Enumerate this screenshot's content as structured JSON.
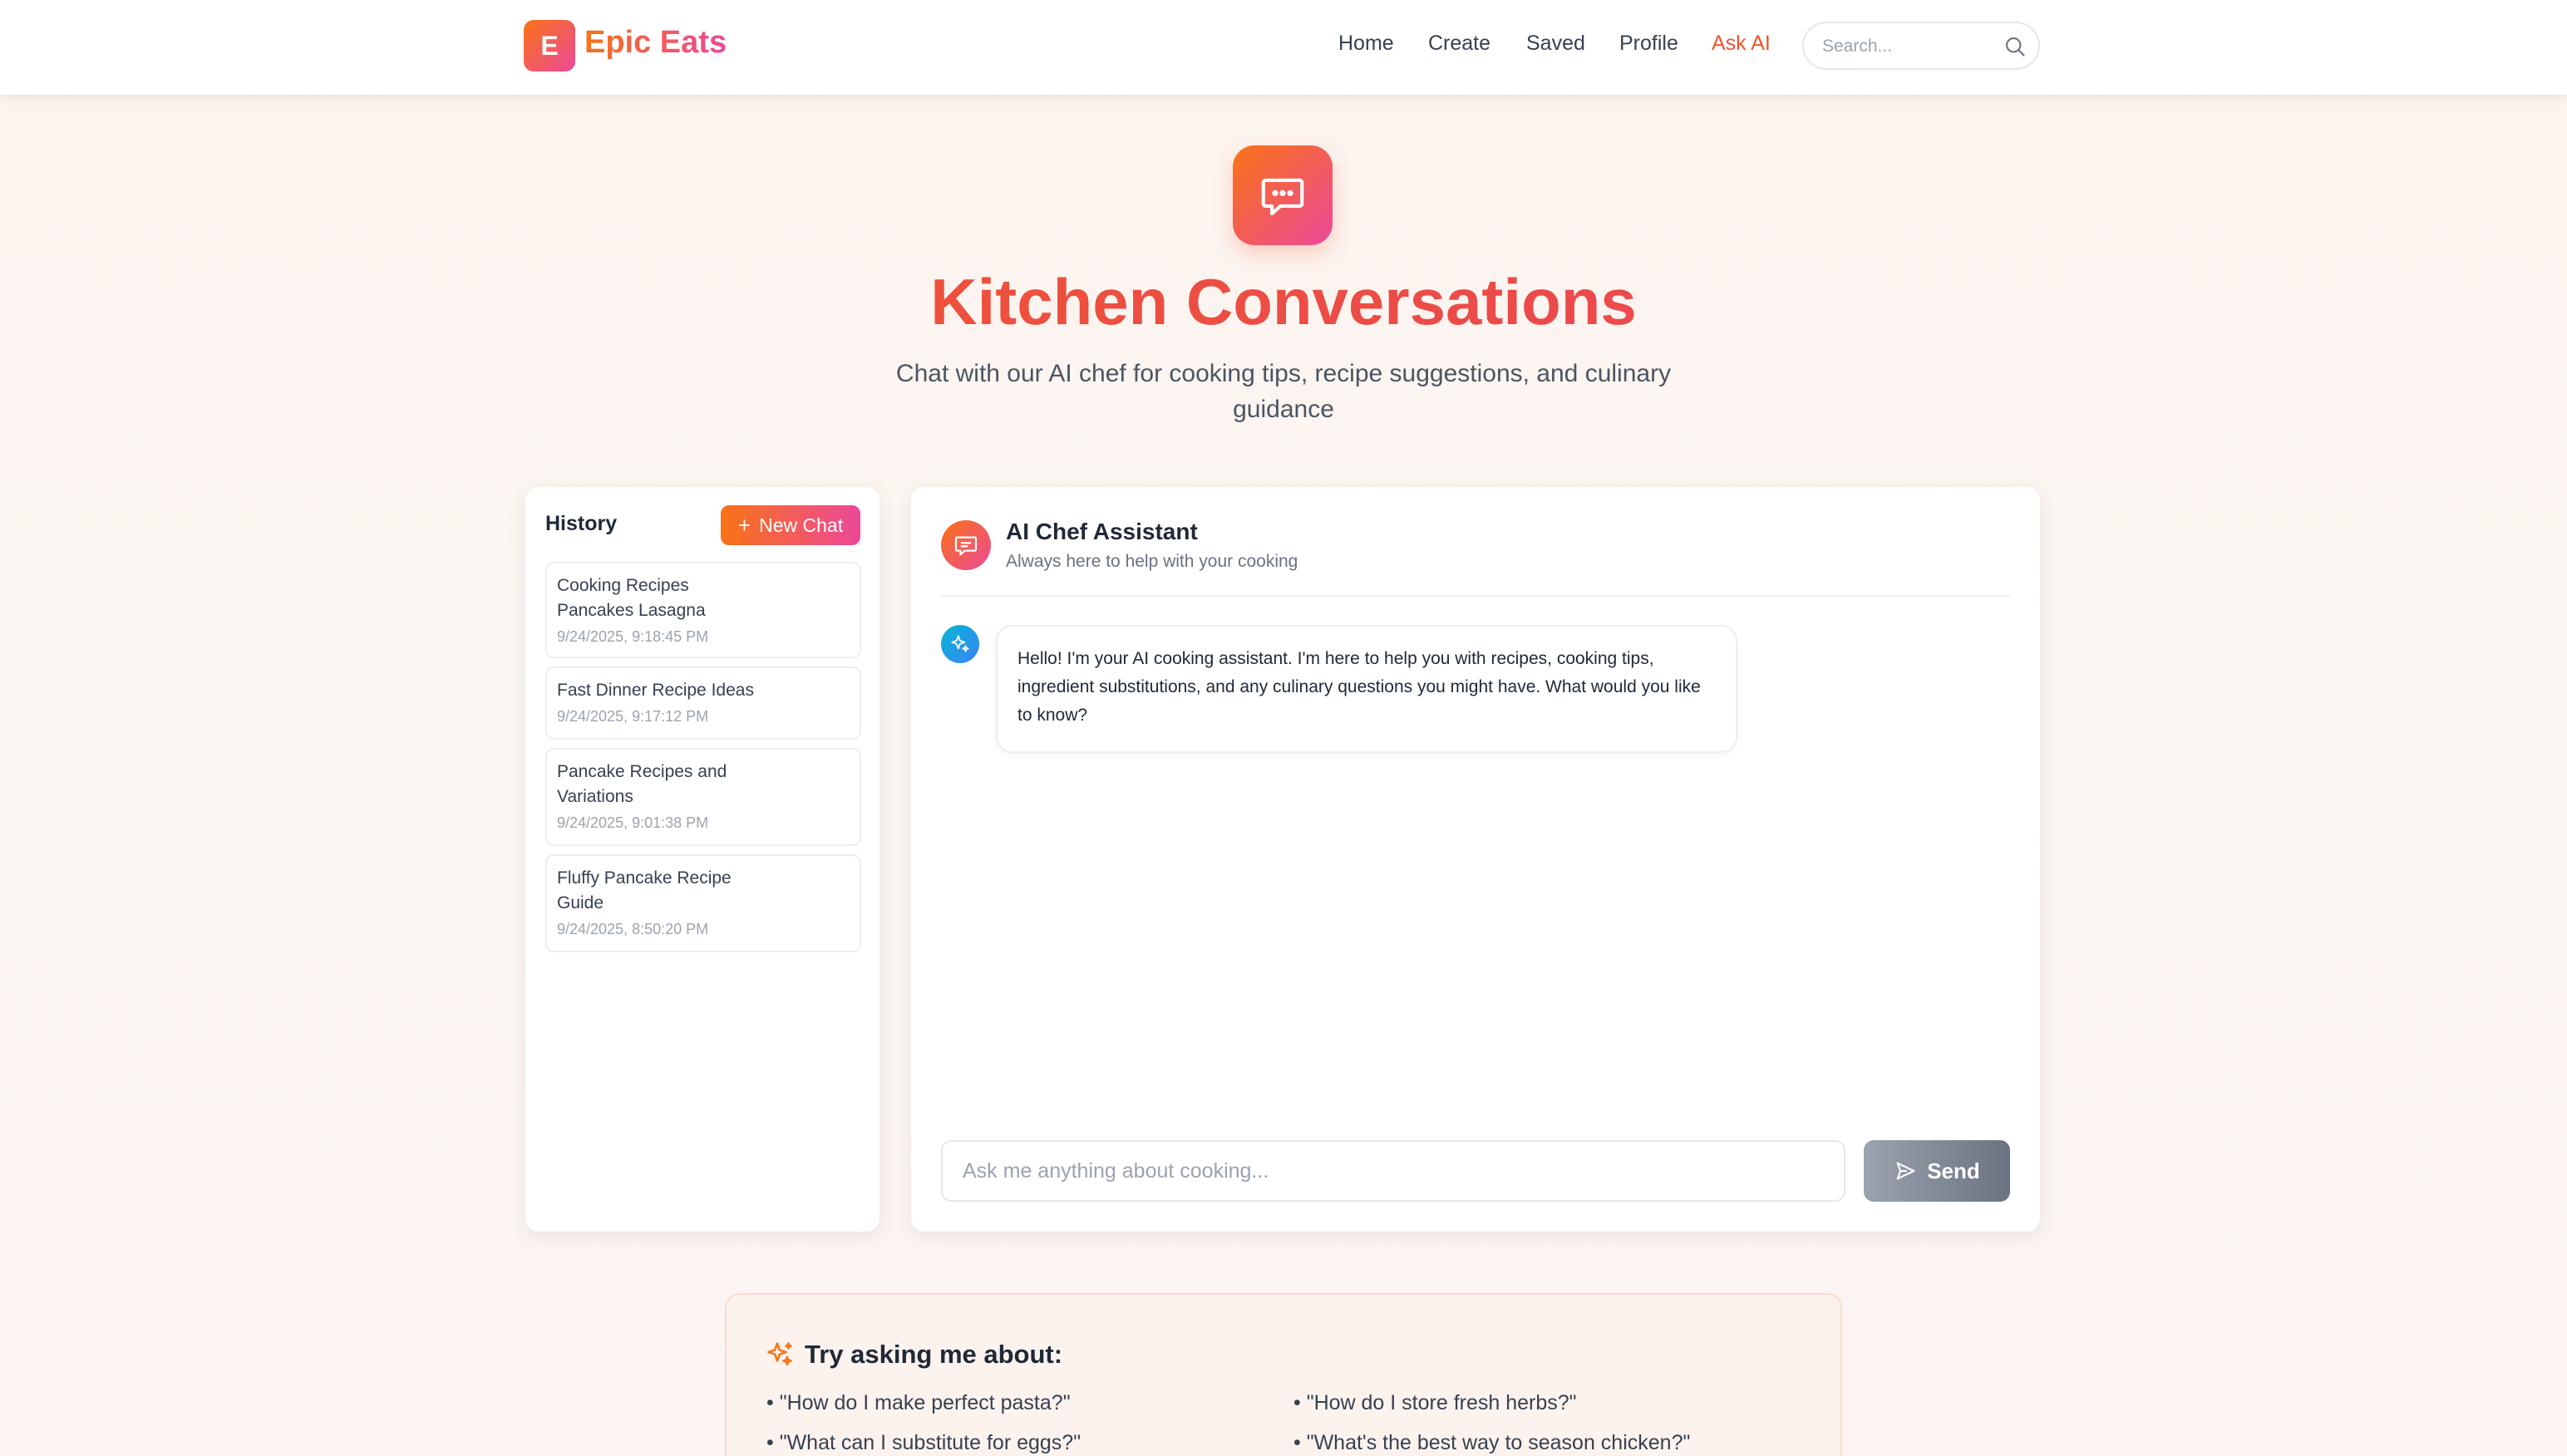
{
  "brand": {
    "logo_letter": "E",
    "name": "Epic Eats"
  },
  "nav": {
    "items": [
      {
        "label": "Home"
      },
      {
        "label": "Create"
      },
      {
        "label": "Saved"
      },
      {
        "label": "Profile"
      },
      {
        "label": "Ask AI",
        "active": true
      }
    ]
  },
  "search": {
    "placeholder": "Search..."
  },
  "hero": {
    "icon": "chat-bubble-icon",
    "title": "Kitchen Conversations",
    "subtitle": "Chat with our AI chef for cooking tips, recipe suggestions, and culinary guidance"
  },
  "history": {
    "title": "History",
    "new_chat_label": "New Chat",
    "items": [
      {
        "title": "Cooking Recipes Pancakes Lasagna",
        "date": "9/24/2025, 9:18:45 PM"
      },
      {
        "title": "Fast Dinner Recipe Ideas",
        "date": "9/24/2025, 9:17:12 PM"
      },
      {
        "title": "Pancake Recipes and Variations",
        "date": "9/24/2025, 9:01:38 PM"
      },
      {
        "title": "Fluffy Pancake Recipe Guide",
        "date": "9/24/2025, 8:50:20 PM"
      }
    ]
  },
  "chat": {
    "assistant_name": "AI Chef Assistant",
    "assistant_status": "Always here to help with your cooking",
    "messages": [
      {
        "role": "assistant",
        "text": "Hello! I'm your AI cooking assistant. I'm here to help you with recipes, cooking tips, ingredient substitutions, and any culinary questions you might have. What would you like to know?"
      }
    ],
    "input_placeholder": "Ask me anything about cooking...",
    "send_label": "Send"
  },
  "suggestions": {
    "title": "Try asking me about:",
    "items": [
      "• \"How do I make perfect pasta?\"",
      "• \"How do I store fresh herbs?\"",
      "• \"What can I substitute for eggs?\"",
      "• \"What's the best way to season chicken?\""
    ]
  },
  "colors": {
    "brand_orange": "#f97316",
    "brand_pink": "#ec4899",
    "active_nav": "#f0532d",
    "send_disabled": "#9ca3af"
  }
}
